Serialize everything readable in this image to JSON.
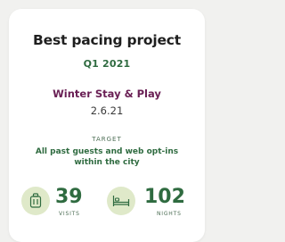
{
  "card": {
    "title": "Best pacing project",
    "period": "Q1 2021",
    "campaign": "Winter Stay & Play",
    "date": "2.6.21",
    "target_label": "TARGET",
    "target_text": "All past guests and web opt-ins within the city"
  },
  "stats": {
    "visits": {
      "value": "39",
      "label": "VISITS",
      "icon": "luggage-icon"
    },
    "nights": {
      "value": "102",
      "label": "NIGHTS",
      "icon": "bed-icon"
    }
  },
  "colors": {
    "accent_green": "#2f6b40",
    "accent_purple": "#6a2055",
    "icon_bg": "#dfe9c9"
  }
}
